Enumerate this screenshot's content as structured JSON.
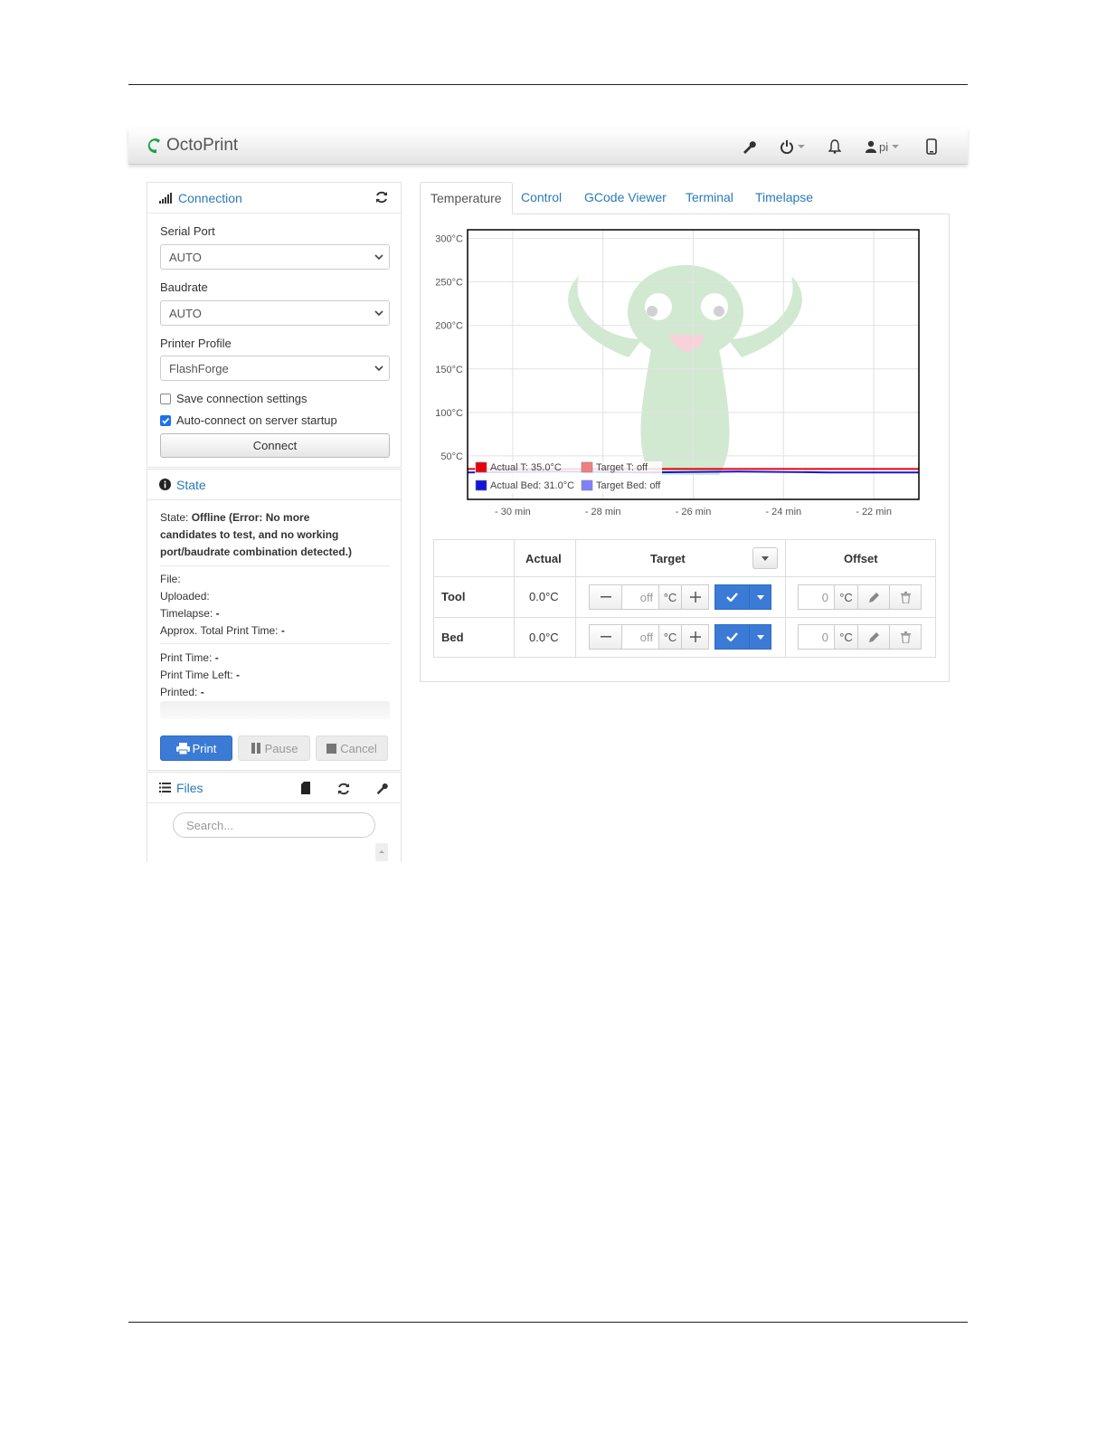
{
  "brand": {
    "name": "OctoPrint"
  },
  "navbar": {
    "user": "pi"
  },
  "colors": {
    "accent": "#2a7ab8",
    "primary_button": "#3b7bd6",
    "brand_green": "#19a347"
  },
  "connection": {
    "title": "Connection",
    "serial_port_label": "Serial Port",
    "serial_port_value": "AUTO",
    "baudrate_label": "Baudrate",
    "baudrate_value": "AUTO",
    "printer_profile_label": "Printer Profile",
    "printer_profile_value": "FlashForge",
    "save_settings_label": "Save connection settings",
    "save_settings_checked": false,
    "autoconnect_label": "Auto-connect on server startup",
    "autoconnect_checked": true,
    "connect_button": "Connect"
  },
  "state": {
    "title": "State",
    "state_label": "State:",
    "state_value_1": "Offline (Error: No more",
    "state_value_2": "candidates to test, and no working",
    "state_value_3": "port/baudrate combination detected.)",
    "file_label": "File:",
    "uploaded_label": "Uploaded:",
    "timelapse_label": "Timelapse:",
    "timelapse_value": "-",
    "approx_total_label": "Approx. Total Print Time:",
    "approx_total_value": "-",
    "print_time_label": "Print Time:",
    "print_time_value": "-",
    "print_time_left_label": "Print Time Left:",
    "print_time_left_value": "-",
    "printed_label": "Printed:",
    "printed_value": "-",
    "print_button": "Print",
    "pause_button": "Pause",
    "cancel_button": "Cancel"
  },
  "files": {
    "title": "Files",
    "search_placeholder": "Search..."
  },
  "tabs": [
    "Temperature",
    "Control",
    "GCode Viewer",
    "Terminal",
    "Timelapse"
  ],
  "chart_data": {
    "type": "line",
    "x_ticks": [
      "- 30 min",
      "- 28 min",
      "- 26 min",
      "- 24 min",
      "- 22 min"
    ],
    "y_ticks": [
      "300°C",
      "250°C",
      "200°C",
      "150°C",
      "100°C",
      "50°C"
    ],
    "ylim": [
      0,
      310
    ],
    "grid": true,
    "legend_position": "bottom-left",
    "legend": [
      "Actual T: 35.0°C",
      "Target T: off",
      "Actual Bed: 31.0°C",
      "Target Bed: off"
    ],
    "series": [
      {
        "name": "Actual T",
        "color": "#e8000b",
        "x": [
          -31,
          -21
        ],
        "y": [
          35,
          35
        ]
      },
      {
        "name": "Actual Bed",
        "color": "#1414d8",
        "x": [
          -31,
          -29,
          -27,
          -25,
          -23,
          -21
        ],
        "y": [
          31,
          32,
          31,
          32,
          31,
          31
        ]
      }
    ]
  },
  "temp_table": {
    "header_actual": "Actual",
    "header_target": "Target",
    "header_offset": "Offset",
    "rows": [
      {
        "name": "Tool",
        "actual": "0.0°C",
        "target_placeholder": "off",
        "unit": "°C",
        "offset": "0"
      },
      {
        "name": "Bed",
        "actual": "0.0°C",
        "target_placeholder": "off",
        "unit": "°C",
        "offset": "0"
      }
    ]
  }
}
